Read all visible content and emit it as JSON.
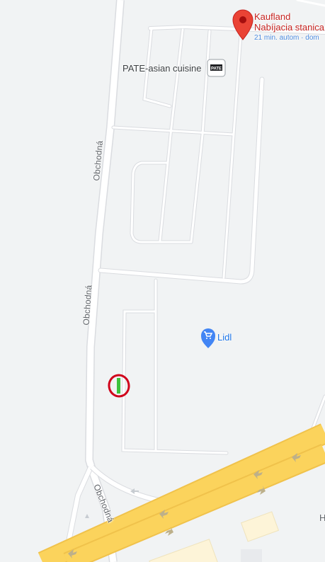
{
  "map": {
    "background": "#f1f3f4",
    "road_color": "#ffffff",
    "highway_color": "#fbd35c",
    "highway_border": "#f0c24b",
    "annotation_color": "#d0021b",
    "marker_color": "#3ec23e"
  },
  "pois": {
    "kaufland": {
      "name_line1": "Kaufland",
      "name_line2": "Nabíjacia stanica",
      "subtitle": "21 min. autom · dom",
      "icon": "red-pin-icon",
      "color": "#ea4335"
    },
    "pate": {
      "name": "PATE-asian cuisine",
      "icon": "restaurant-logo-icon",
      "logo_text": "PATE"
    },
    "lidl": {
      "name": "Lidl",
      "icon": "shopping-cart-pin-icon",
      "color": "#4285f4"
    }
  },
  "streets": {
    "obchodna_upper": "Obchodná",
    "obchodna_middle": "Obchodná",
    "obchodna_lower": "Obchodná"
  },
  "edge_label": "H"
}
